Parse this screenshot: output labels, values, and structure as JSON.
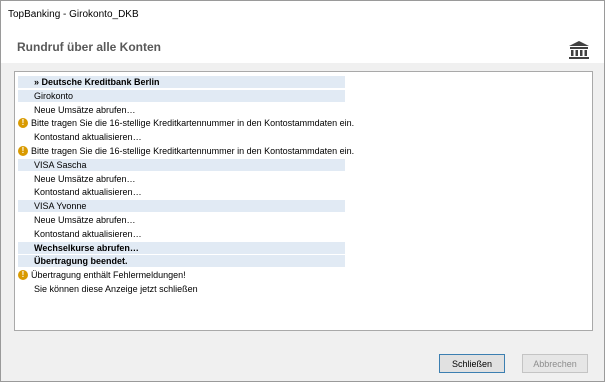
{
  "window": {
    "title": "TopBanking - Girokonto_DKB"
  },
  "header": {
    "title": "Rundruf über alle Konten",
    "icon": "bank-icon"
  },
  "log": {
    "rows": [
      {
        "text": "» Deutsche Kreditbank Berlin",
        "bold": true,
        "highlight": true,
        "warning": false
      },
      {
        "text": "Girokonto",
        "bold": false,
        "highlight": true,
        "warning": false
      },
      {
        "text": "Neue Umsätze abrufen…",
        "bold": false,
        "highlight": false,
        "warning": false
      },
      {
        "text": "Bitte tragen Sie die 16-stellige Kreditkartennummer in den Kontostammdaten ein.",
        "bold": false,
        "highlight": false,
        "warning": true
      },
      {
        "text": "Kontostand aktualisieren…",
        "bold": false,
        "highlight": false,
        "warning": false
      },
      {
        "text": "Bitte tragen Sie die 16-stellige Kreditkartennummer in den Kontostammdaten ein.",
        "bold": false,
        "highlight": false,
        "warning": true
      },
      {
        "text": "VISA Sascha",
        "bold": false,
        "highlight": true,
        "warning": false
      },
      {
        "text": "Neue Umsätze abrufen…",
        "bold": false,
        "highlight": false,
        "warning": false
      },
      {
        "text": "Kontostand aktualisieren…",
        "bold": false,
        "highlight": false,
        "warning": false
      },
      {
        "text": "VISA Yvonne",
        "bold": false,
        "highlight": true,
        "warning": false
      },
      {
        "text": "Neue Umsätze abrufen…",
        "bold": false,
        "highlight": false,
        "warning": false
      },
      {
        "text": "Kontostand aktualisieren…",
        "bold": false,
        "highlight": false,
        "warning": false
      },
      {
        "text": "Wechselkurse abrufen…",
        "bold": true,
        "highlight": true,
        "warning": false
      },
      {
        "text": "Übertragung beendet.",
        "bold": true,
        "highlight": true,
        "warning": false
      },
      {
        "text": "Übertragung enthält Fehlermeldungen!",
        "bold": false,
        "highlight": false,
        "warning": true
      },
      {
        "text": "Sie können diese Anzeige jetzt schließen",
        "bold": false,
        "highlight": false,
        "warning": false
      }
    ],
    "warning_icon": "warning-icon",
    "highlight_color": "#e1eaf4",
    "warning_color": "#d99a00"
  },
  "buttons": {
    "close_label": "Schließen",
    "cancel_label": "Abbrechen",
    "cancel_enabled": false
  }
}
